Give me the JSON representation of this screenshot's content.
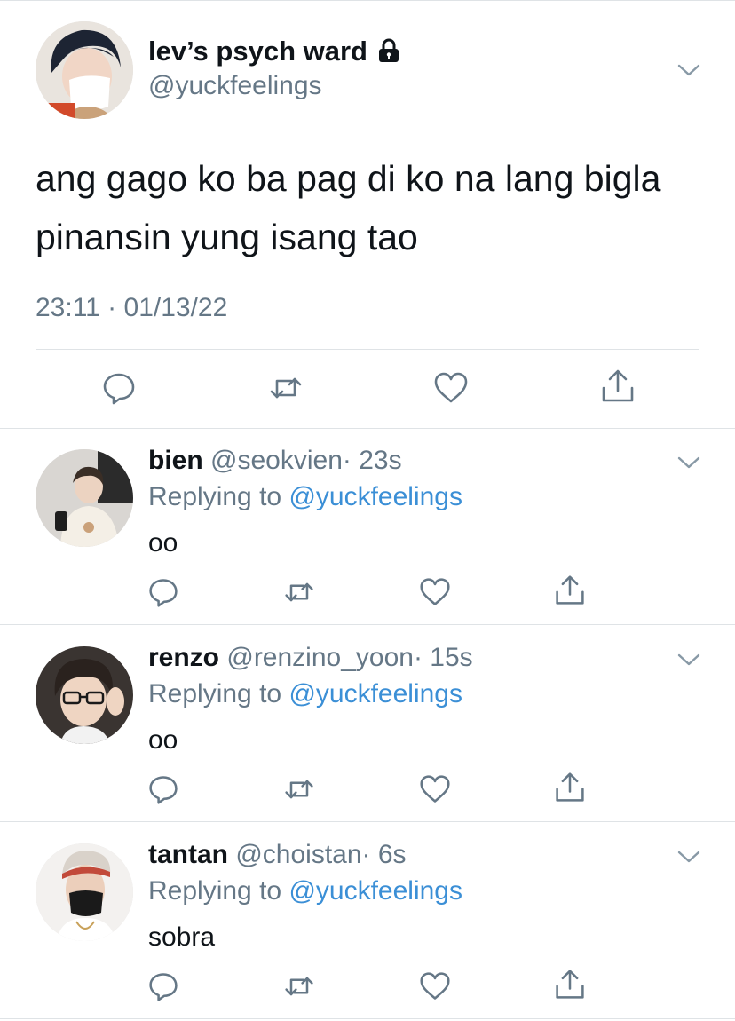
{
  "main_tweet": {
    "display_name": "lev’s psych ward",
    "handle": "@yuckfeelings",
    "text": "ang gago ko ba pag di ko na lang bigla pinansin yung isang tao",
    "timestamp": "23:11 · 01/13/22",
    "icons": [
      "lock-icon",
      "chevron-down-icon",
      "reply-icon",
      "retweet-icon",
      "like-icon",
      "share-icon"
    ]
  },
  "replies": [
    {
      "display_name": "bien",
      "handle": "@seokvien",
      "time": "· 23s",
      "replying_prefix": "Replying to",
      "replying_to": "@yuckfeelings",
      "text": "oo"
    },
    {
      "display_name": "renzo",
      "handle": "@renzino_yoon",
      "time": "· 15s",
      "replying_prefix": "Replying to",
      "replying_to": "@yuckfeelings",
      "text": "oo"
    },
    {
      "display_name": "tantan",
      "handle": "@choistan",
      "time": "· 6s",
      "replying_prefix": "Replying to",
      "replying_to": "@yuckfeelings",
      "text": "sobra"
    }
  ],
  "colors": {
    "text_primary": "#0f1419",
    "text_secondary": "#657786",
    "link": "#3b8fd6",
    "divider": "#dfe3e6",
    "icon": "#657786"
  }
}
